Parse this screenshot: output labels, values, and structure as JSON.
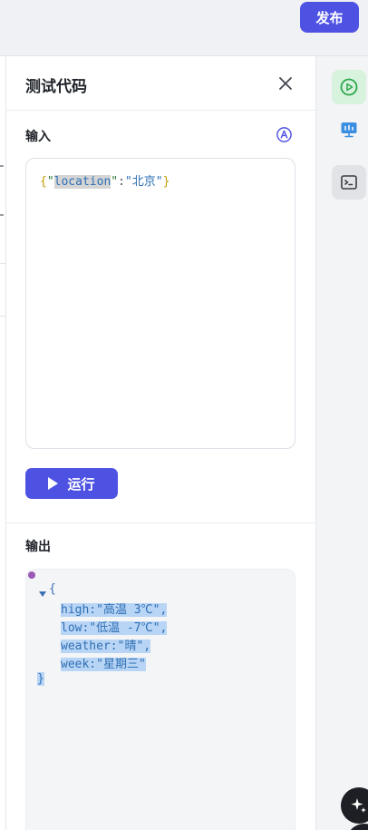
{
  "toolbar": {
    "publish_label": "发布"
  },
  "panel": {
    "title": "测试代码",
    "input_label": "输入",
    "input_code": {
      "open_brace": "{",
      "key_quote_open": "\"",
      "key": "location",
      "key_quote_close": "\"",
      "colon": ":",
      "value": "\"北京\"",
      "close_brace": "}"
    },
    "run_label": "运行",
    "output_label": "输出",
    "output_lines": {
      "open": "{",
      "line1": "high:\"高温 3℃\",",
      "line2": "low:\"低温 -7℃\",",
      "line3": "weather:\"晴\",",
      "line4": "week:\"星期三\"",
      "close": "}"
    }
  },
  "icons": {
    "close": "close-icon",
    "auto": "a-circle-icon",
    "run_test": "play-circle-icon",
    "monitor": "monitor-icon",
    "terminal": "terminal-icon",
    "ai": "sparkle-icon"
  },
  "colors": {
    "accent": "#4e52e3",
    "active_tab_bg": "#d7f2dd",
    "active_tab_icon": "#2fa84f",
    "selection": "#b9d5f5"
  }
}
